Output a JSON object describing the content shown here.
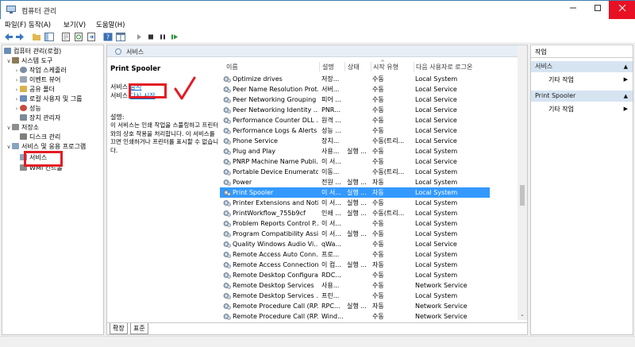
{
  "window": {
    "title": "컴퓨터 관리"
  },
  "menu": [
    "파일(F)",
    "동작(A)",
    "보기(V)",
    "도움말(H)"
  ],
  "tree": {
    "items": [
      {
        "label": "컴퓨터 관리(로컬)",
        "chev": "",
        "icon": "computer-icon",
        "color": "#6a8fb5"
      },
      {
        "label": "시스템 도구",
        "chev": "∨",
        "icon": "tools-icon",
        "color": "#8c7a5a"
      },
      {
        "label": "작업 스케줄러",
        "chev": "›",
        "icon": "clock-icon",
        "color": "#7a8fa3"
      },
      {
        "label": "이벤트 뷰어",
        "chev": "›",
        "icon": "event-viewer-icon",
        "color": "#9aa7b3"
      },
      {
        "label": "공유 폴더",
        "chev": "›",
        "icon": "shared-folder-icon",
        "color": "#d9b24a"
      },
      {
        "label": "로컬 사용자 및 그룹",
        "chev": "›",
        "icon": "users-icon",
        "color": "#6b8db8"
      },
      {
        "label": "성능",
        "chev": "›",
        "icon": "performance-icon",
        "color": "#c74b3c"
      },
      {
        "label": "장치 관리자",
        "chev": "",
        "icon": "device-manager-icon",
        "color": "#7c8a99"
      },
      {
        "label": "저장소",
        "chev": "∨",
        "icon": "storage-icon",
        "color": "#8d8d8d"
      },
      {
        "label": "디스크 관리",
        "chev": "",
        "icon": "disk-icon",
        "color": "#7e7e7e"
      },
      {
        "label": "서비스 및 응용 프로그램",
        "chev": "∨",
        "icon": "services-apps-icon",
        "color": "#8aa3bd"
      },
      {
        "label": "서비스",
        "chev": "",
        "icon": "services-icon",
        "color": "#8aa3bd"
      },
      {
        "label": "WMI 컨트롤",
        "chev": "",
        "icon": "wmi-icon",
        "color": "#8a8a8a"
      }
    ]
  },
  "center": {
    "header": "서비스",
    "selected_service": "Print Spooler",
    "action_stop_prefix": "서비스",
    "action_stop_link": "중지",
    "action_restart_prefix": "서비스",
    "action_restart_link": "다시 시작",
    "description_label": "설명:",
    "description": "이 서비스는 인쇄 작업을 스풀링하고 프린터와의 상호 작용을 처리합니다. 이 서비스를 끄면 인쇄하거나 프린터를 표시할 수 없습니다.",
    "columns": [
      "이름",
      "설명",
      "상태",
      "시작 유형",
      "다음 사용자로 로그온"
    ],
    "rows": [
      {
        "name": "Optimize drives",
        "desc": "저장...",
        "state": "",
        "start": "수동",
        "logon": "Local System"
      },
      {
        "name": "Peer Name Resolution Prot...",
        "desc": "서버...",
        "state": "",
        "start": "수동",
        "logon": "Local Service"
      },
      {
        "name": "Peer Networking Grouping",
        "desc": "피어 ...",
        "state": "",
        "start": "수동",
        "logon": "Local Service"
      },
      {
        "name": "Peer Networking Identity ...",
        "desc": "PNR...",
        "state": "",
        "start": "수동",
        "logon": "Local Service"
      },
      {
        "name": "Performance Counter DLL ...",
        "desc": "원격 ...",
        "state": "",
        "start": "수동",
        "logon": "Local Service"
      },
      {
        "name": "Performance Logs & Alerts",
        "desc": "성능 ...",
        "state": "",
        "start": "수동",
        "logon": "Local Service"
      },
      {
        "name": "Phone Service",
        "desc": "장치...",
        "state": "",
        "start": "수동(트리...",
        "logon": "Local Service"
      },
      {
        "name": "Plug and Play",
        "desc": "사용...",
        "state": "실행 ...",
        "start": "수동",
        "logon": "Local System"
      },
      {
        "name": "PNRP Machine Name Publi...",
        "desc": "이 서...",
        "state": "",
        "start": "수동",
        "logon": "Local Service"
      },
      {
        "name": "Portable Device Enumerato...",
        "desc": "이동...",
        "state": "",
        "start": "수동(트리...",
        "logon": "Local System"
      },
      {
        "name": "Power",
        "desc": "전원 ...",
        "state": "실행 ...",
        "start": "자동",
        "logon": "Local System"
      },
      {
        "name": "Print Spooler",
        "desc": "이 서...",
        "state": "실행 ...",
        "start": "자동",
        "logon": "Local System",
        "selected": true
      },
      {
        "name": "Printer Extensions and Noti...",
        "desc": "이 서...",
        "state": "실행 ...",
        "start": "수동",
        "logon": "Local System"
      },
      {
        "name": "PrintWorkflow_755b9cf",
        "desc": "인쇄 ...",
        "state": "실행 ...",
        "start": "수동(트리...",
        "logon": "Local System"
      },
      {
        "name": "Problem Reports Control P...",
        "desc": "이 서...",
        "state": "",
        "start": "수동",
        "logon": "Local System"
      },
      {
        "name": "Program Compatibility Assi...",
        "desc": "이 서...",
        "state": "실행 ...",
        "start": "수동",
        "logon": "Local System"
      },
      {
        "name": "Quality Windows Audio Vi...",
        "desc": "qWa...",
        "state": "",
        "start": "수동",
        "logon": "Local Service"
      },
      {
        "name": "Remote Access Auto Conn...",
        "desc": "프로...",
        "state": "",
        "start": "수동",
        "logon": "Local System"
      },
      {
        "name": "Remote Access Connection...",
        "desc": "이 컴...",
        "state": "실행 ...",
        "start": "자동",
        "logon": "Local System"
      },
      {
        "name": "Remote Desktop Configura...",
        "desc": "RDC...",
        "state": "",
        "start": "수동",
        "logon": "Local System"
      },
      {
        "name": "Remote Desktop Services",
        "desc": "사용...",
        "state": "",
        "start": "수동",
        "logon": "Network Service"
      },
      {
        "name": "Remote Desktop Services ...",
        "desc": "프린...",
        "state": "",
        "start": "수동",
        "logon": "Local System"
      },
      {
        "name": "Remote Procedure Call (RP...",
        "desc": "RPC...",
        "state": "실행 ...",
        "start": "자동",
        "logon": "Network Service"
      },
      {
        "name": "Remote Procedure Call (RP...",
        "desc": "Wind...",
        "state": "",
        "start": "수동",
        "logon": "Network Service"
      }
    ],
    "tabs": [
      "확장",
      "표준"
    ]
  },
  "actions": {
    "title": "작업",
    "sections": [
      {
        "title": "서비스",
        "item": "기타 작업"
      },
      {
        "title": "Print Spooler",
        "item": "기타 작업"
      }
    ]
  },
  "colors": {
    "selection": "#3399ff",
    "annotation": "#e31b23",
    "link": "#0066cc",
    "close": "#e81123"
  }
}
